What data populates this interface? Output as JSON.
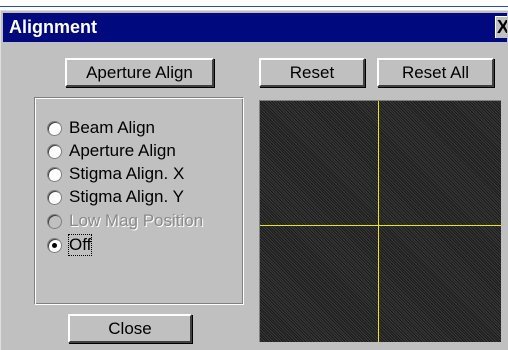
{
  "window": {
    "title": "Alignment",
    "close_glyph": "X"
  },
  "buttons": {
    "aperture_align": "Aperture Align",
    "reset": "Reset",
    "reset_all": "Reset All",
    "close": "Close"
  },
  "radio_group": {
    "options": [
      {
        "label": "Beam Align",
        "selected": false,
        "enabled": true
      },
      {
        "label": "Aperture Align",
        "selected": false,
        "enabled": true
      },
      {
        "label": "Stigma Align. X",
        "selected": false,
        "enabled": true
      },
      {
        "label": "Stigma Align. Y",
        "selected": false,
        "enabled": true
      },
      {
        "label": "Low Mag Position",
        "selected": false,
        "enabled": false
      },
      {
        "label": "Off",
        "selected": true,
        "enabled": true
      }
    ]
  },
  "display": {
    "crosshair_color": "#e8e800",
    "background_color": "#262626"
  },
  "colors": {
    "title_bar": "#000a7e",
    "dialog_face": "#c0c0c0"
  }
}
